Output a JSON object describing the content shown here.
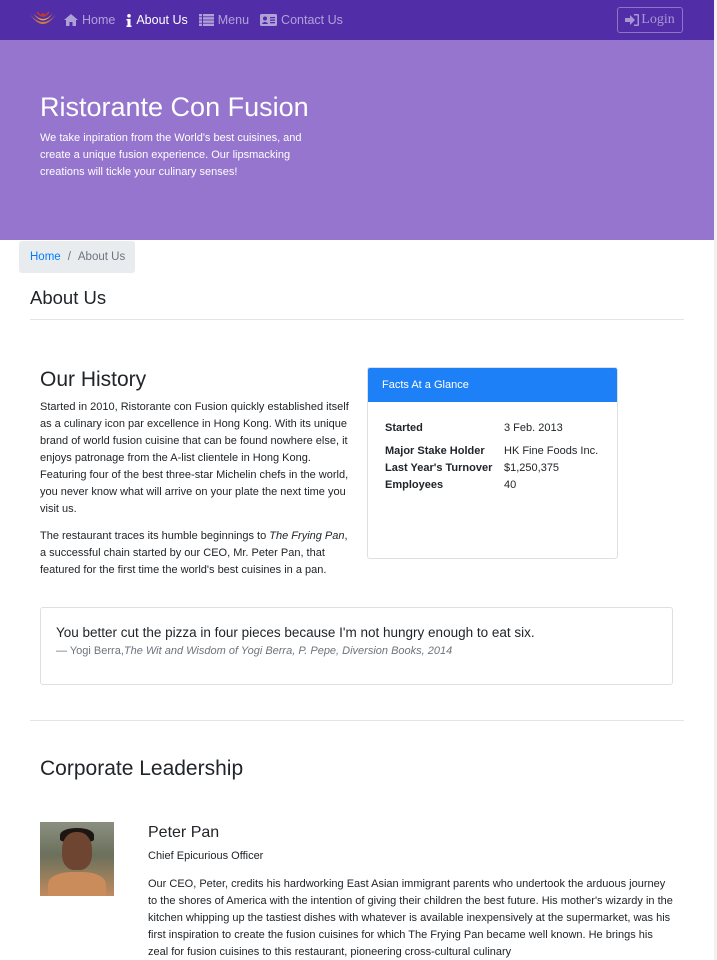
{
  "navbar": {
    "brand_icon": "restaurant-logo",
    "items": [
      {
        "label": "Home",
        "icon": "home-icon",
        "active": false
      },
      {
        "label": "About Us",
        "icon": "info-icon",
        "active": true
      },
      {
        "label": "Menu",
        "icon": "list-icon",
        "active": false
      },
      {
        "label": "Contact Us",
        "icon": "address-card-icon",
        "active": false
      }
    ],
    "login_label": "Login",
    "login_icon": "sign-in-icon"
  },
  "jumbotron": {
    "title": "Ristorante Con Fusion",
    "text": "We take inpiration from the World's best cuisines, and create a unique fusion experience. Our lipsmacking creations will tickle your culinary senses!"
  },
  "breadcrumb": {
    "home": "Home",
    "separator": "/",
    "current": "About Us"
  },
  "page_title": "About Us",
  "history": {
    "title": "Our History",
    "p1": "Started in 2010, Ristorante con Fusion quickly established itself as a culinary icon par excellence in Hong Kong. With its unique brand of world fusion cuisine that can be found nowhere else, it enjoys patronage from the A-list clientele in Hong Kong. Featuring four of the best three-star Michelin chefs in the world, you never know what will arrive on your plate the next time you visit us.",
    "p2_before": "The restaurant traces its humble beginnings to ",
    "p2_italic": "The Frying Pan",
    "p2_after": ", a successful chain started by our CEO, Mr. Peter Pan, that featured for the first time the world's best cuisines in a pan."
  },
  "facts": {
    "header": "Facts At a Glance",
    "rows": [
      {
        "label": "Started",
        "value": "3 Feb. 2013"
      },
      {
        "label": "Major Stake Holder",
        "value": "HK Fine Foods Inc."
      },
      {
        "label": "Last Year's Turnover",
        "value": "$1,250,375"
      },
      {
        "label": "Employees",
        "value": "40"
      }
    ]
  },
  "quote": {
    "text": "You better cut the pizza in four pieces because I'm not hungry enough to eat six.",
    "author": "— Yogi Berra,",
    "source": "The Wit and Wisdom of Yogi Berra, P. Pepe, Diversion Books, 2014"
  },
  "leadership": {
    "title": "Corporate Leadership",
    "leaders": [
      {
        "name": "Peter Pan",
        "role": "Chief Epicurious Officer",
        "description": "Our CEO, Peter, credits his hardworking East Asian immigrant parents who undertook the arduous journey to the shores of America with the intention of giving their children the best future. His mother's wizardy in the kitchen whipping up the tastiest dishes with whatever is available inexpensively at the supermarket, was his first inspiration to create the fusion cuisines for which The Frying Pan became well known. He brings his zeal for fusion cuisines to this restaurant, pioneering cross-cultural culinary"
      }
    ]
  },
  "colors": {
    "navbar": "#512da8",
    "jumbotron": "#9575cd",
    "card_header": "#1e80f7",
    "link": "#007bff"
  }
}
